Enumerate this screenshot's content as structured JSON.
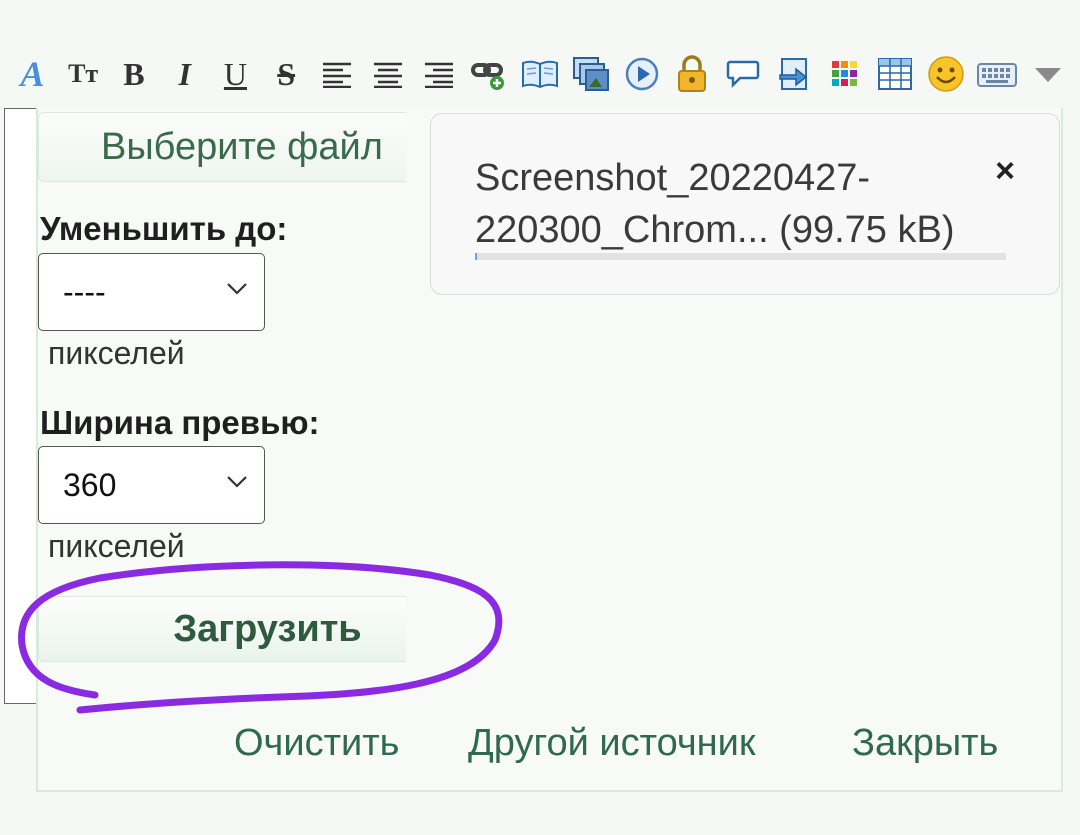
{
  "dialog": {
    "choose_file_label": "Выберите файл",
    "resize_label": "Уменьшить до:",
    "resize_value": "----",
    "resize_unit": "пикселей",
    "preview_label": "Ширина превью:",
    "preview_value": "360",
    "preview_unit": "пикселей",
    "upload_label": "Загрузить"
  },
  "file": {
    "name_line1": "Screenshot_20220427-",
    "name_line2": "220300_Chrom... (99.75 kB)",
    "close_label": "×",
    "progress_fraction": 0.004
  },
  "actions": {
    "clear": "Очистить",
    "other_source": "Другой источник",
    "close": "Закрыть"
  },
  "colors": {
    "accent_green": "#2f6a4e",
    "annotation_purple": "#8a2be2",
    "progress_track": "#e1e2e3"
  },
  "toolbar": {
    "icons": [
      "font-color-icon",
      "font-size-icon",
      "bold-icon",
      "italic-icon",
      "underline-icon",
      "strikethrough-icon",
      "align-left-icon",
      "align-center-icon",
      "align-right-icon",
      "link-icon",
      "book-icon",
      "gallery-icon",
      "video-icon",
      "lock-icon",
      "comment-icon",
      "document-icon",
      "color-grid-icon",
      "table-icon",
      "smiley-icon",
      "keyboard-icon",
      "more-dropdown-icon"
    ],
    "glyphs": {
      "font": "A",
      "font_size": "Tт",
      "bold": "B",
      "italic": "I",
      "underline": "U",
      "strike": "S"
    }
  }
}
